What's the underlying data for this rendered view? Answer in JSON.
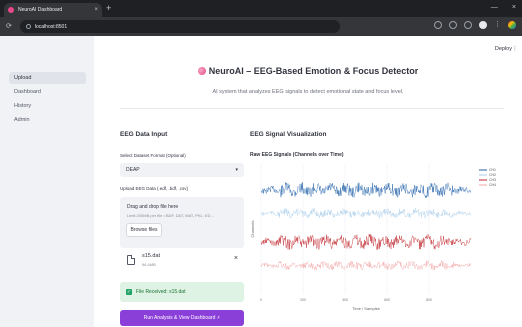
{
  "browser": {
    "tab_title": "NeuroAI Dashboard",
    "tab_close": "×",
    "new_tab": "+",
    "url": "localhost:8501",
    "win_minimize": "—",
    "win_close": "×"
  },
  "sidebar": {
    "items": [
      {
        "label": "Upload",
        "active": true
      },
      {
        "label": "Dashboard",
        "active": false
      },
      {
        "label": "History",
        "active": false
      },
      {
        "label": "Admin",
        "active": false
      }
    ]
  },
  "header": {
    "deploy_label": "Deploy",
    "menu_glyph": "⋮"
  },
  "main": {
    "title": "NeuroAI – EEG-Based Emotion & Focus Detector",
    "subtitle": "AI system that analyzes EEG signals to detect emotional state and focus level."
  },
  "input": {
    "heading": "EEG Data Input",
    "format_label": "Select Dataset Format (Optional)",
    "format_value": "DEAP",
    "upload_label": "Upload EEG Data (.edf, .bdf, .csv)",
    "drop_title": "Drag and drop file here",
    "drop_limit": "Limit 200MB per file • BDF, DAT, MAT, PKL, ED...",
    "browse_label": "Browse files",
    "file_name": "s15.dat",
    "file_size": "96.4MB",
    "success_text": "File Received: s15.dat",
    "run_label": "Run Analysis & View Dashboard ⚡"
  },
  "viz": {
    "heading": "EEG Signal Visualization",
    "chart_title": "Raw EEG Signals (Channels over Time)"
  },
  "chart_data": {
    "type": "line",
    "title": "Raw EEG Signals (Channels over Time)",
    "xlabel": "Time / Samples",
    "ylabel": "Channels",
    "x_ticks": [
      "0",
      "200",
      "400",
      "600",
      "800"
    ],
    "xlim": [
      0,
      1000
    ],
    "grid": true,
    "legend_position": "right",
    "series": [
      {
        "name": "CH1",
        "color": "#1f5fa8"
      },
      {
        "name": "CH2",
        "color": "#a9cdea"
      },
      {
        "name": "CH3",
        "color": "#c0262d"
      },
      {
        "name": "CH4",
        "color": "#f2a6a6"
      }
    ]
  }
}
